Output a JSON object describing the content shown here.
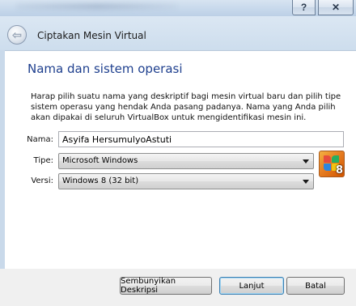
{
  "window": {
    "help_glyph": "?",
    "close_glyph": "✕"
  },
  "header": {
    "back_glyph": "⇦",
    "title": "Ciptakan Mesin Virtual"
  },
  "main": {
    "section_title": "Nama dan sistem operasi",
    "description": "Harap pilih suatu nama yang deskriptif bagi mesin virtual baru dan pilih tipe sistem operasu yang hendak Anda pasang padanya. Nama yang Anda pilih akan dipakai di seluruh VirtualBox untuk mengidentifikasi mesin ini.",
    "name_label": "Nama:",
    "name_value": "Asyifa HersumulyoAstuti",
    "type_label": "Tipe:",
    "type_value": "Microsoft Windows",
    "version_label": "Versi:",
    "version_value": "Windows 8 (32 bit)",
    "os_icon_name": "windows-8-os-icon",
    "os_icon_number": "8"
  },
  "footer": {
    "hide_description_label": "Sembunyikan Deskripsi",
    "next_label": "Lanjut",
    "cancel_label": "Batal"
  },
  "colors": {
    "section_title": "#1e3f8e",
    "header_bg": "#cddded",
    "footer_bg": "#f0f0f0"
  }
}
